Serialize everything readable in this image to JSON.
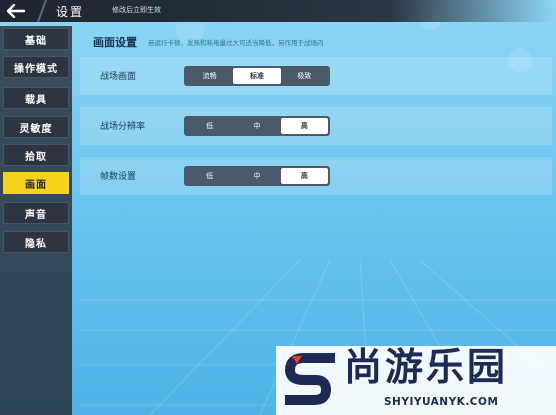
{
  "header": {
    "title": "设置",
    "subtitle": "修改后立即生效"
  },
  "sidebar": {
    "items": [
      {
        "label": "基础",
        "active": false
      },
      {
        "label": "操作模式",
        "active": false
      },
      {
        "label": "载具",
        "active": false
      },
      {
        "label": "灵敏度",
        "active": false
      },
      {
        "label": "拾取",
        "active": false
      },
      {
        "label": "画面",
        "active": true
      },
      {
        "label": "声音",
        "active": false
      },
      {
        "label": "隐私",
        "active": false
      }
    ]
  },
  "main": {
    "section_title": "画面设置",
    "section_note": "若运行卡顿、发热和耗电量过大可适当降低，另作用于战场内",
    "settings": [
      {
        "label": "战场画面",
        "options": [
          "流畅",
          "标准",
          "极致"
        ],
        "selected": 1
      },
      {
        "label": "战场分辨率",
        "options": [
          "低",
          "中",
          "高"
        ],
        "selected": 2
      },
      {
        "label": "帧数设置",
        "options": [
          "低",
          "中",
          "高"
        ],
        "selected": 2
      }
    ]
  },
  "watermark": {
    "text": "尚游乐园",
    "url": "SHYIYUANYK.COM"
  },
  "colors": {
    "accent": "#f6d21a",
    "sidebar_bg": "#262e3a",
    "background": "#6cc6ef"
  }
}
